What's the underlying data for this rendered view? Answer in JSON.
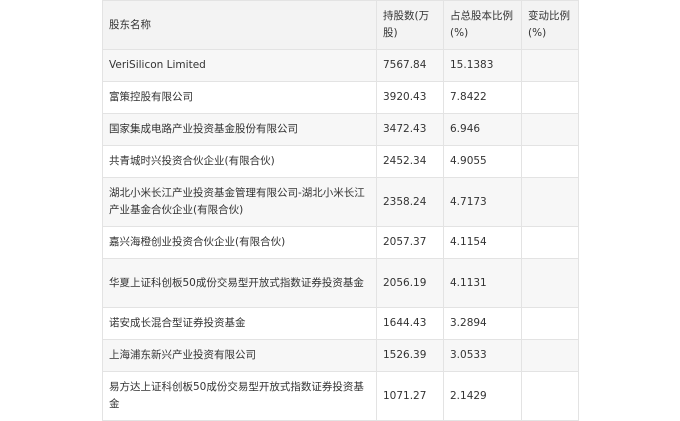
{
  "table": {
    "headers": [
      "股东名称",
      "持股数(万股)",
      "占总股本比例(%)",
      "变动比例(%)"
    ],
    "rows": [
      {
        "name": "VeriSilicon Limited",
        "shares": "7567.84",
        "pct": "15.1383",
        "change": ""
      },
      {
        "name": "富策控股有限公司",
        "shares": "3920.43",
        "pct": "7.8422",
        "change": ""
      },
      {
        "name": "国家集成电路产业投资基金股份有限公司",
        "shares": "3472.43",
        "pct": "6.946",
        "change": ""
      },
      {
        "name": "共青城时兴投资合伙企业(有限合伙)",
        "shares": "2452.34",
        "pct": "4.9055",
        "change": ""
      },
      {
        "name": "湖北小米长江产业投资基金管理有限公司-湖北小米长江产业基金合伙企业(有限合伙)",
        "shares": "2358.24",
        "pct": "4.7173",
        "change": ""
      },
      {
        "name": "嘉兴海橙创业投资合伙企业(有限合伙)",
        "shares": "2057.37",
        "pct": "4.1154",
        "change": ""
      },
      {
        "name": "华夏上证科创板50成份交易型开放式指数证券投资基金",
        "shares": "2056.19",
        "pct": "4.1131",
        "change": ""
      },
      {
        "name": "诺安成长混合型证券投资基金",
        "shares": "1644.43",
        "pct": "3.2894",
        "change": ""
      },
      {
        "name": "上海浦东新兴产业投资有限公司",
        "shares": "1526.39",
        "pct": "3.0533",
        "change": ""
      },
      {
        "name": "易方达上证科创板50成份交易型开放式指数证券投资基金",
        "shares": "1071.27",
        "pct": "2.1429",
        "change": ""
      }
    ]
  }
}
